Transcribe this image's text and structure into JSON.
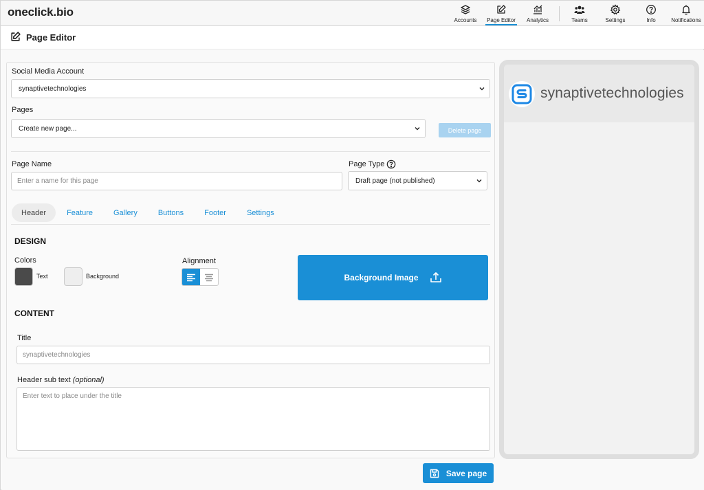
{
  "app": {
    "logo": "oneclick.bio"
  },
  "nav": [
    {
      "label": "Accounts",
      "icon": "layers-icon"
    },
    {
      "label": "Page Editor",
      "icon": "edit-icon",
      "active": true
    },
    {
      "label": "Analytics",
      "icon": "analytics-icon"
    },
    {
      "label": "Teams",
      "icon": "users-icon"
    },
    {
      "label": "Settings",
      "icon": "gear-icon"
    },
    {
      "label": "Info",
      "icon": "help-circle-icon"
    },
    {
      "label": "Notifications",
      "icon": "bell-icon"
    }
  ],
  "page": {
    "title": "Page Editor"
  },
  "form": {
    "account_label": "Social Media Account",
    "account_value": "synaptivetechnologies",
    "pages_label": "Pages",
    "pages_value": "Create new page...",
    "delete_label": "Delete page",
    "page_name_label": "Page Name",
    "page_name_placeholder": "Enter a name for this page",
    "page_type_label": "Page Type",
    "page_type_value": "Draft page (not published)"
  },
  "tabs": [
    "Header",
    "Feature",
    "Gallery",
    "Buttons",
    "Footer",
    "Settings"
  ],
  "active_tab": "Header",
  "design": {
    "heading": "DESIGN",
    "colors_label": "Colors",
    "text_color_label": "Text",
    "text_color": "#4a4a4a",
    "background_color_label": "Background",
    "background_color": "#eeeeee",
    "alignment_label": "Alignment",
    "alignment_value": "left",
    "background_image_label": "Background Image"
  },
  "content": {
    "heading": "CONTENT",
    "title_label": "Title",
    "title_placeholder": "synaptivetechnologies",
    "subtext_label": "Header sub text",
    "subtext_optional": "(optional)",
    "subtext_placeholder": "Enter text to place under the title"
  },
  "save_label": "Save page",
  "preview": {
    "title": "synaptivetechnologies"
  },
  "colors": {
    "accent": "#1a8fd6",
    "accent_disabled": "#a9d3f0"
  }
}
